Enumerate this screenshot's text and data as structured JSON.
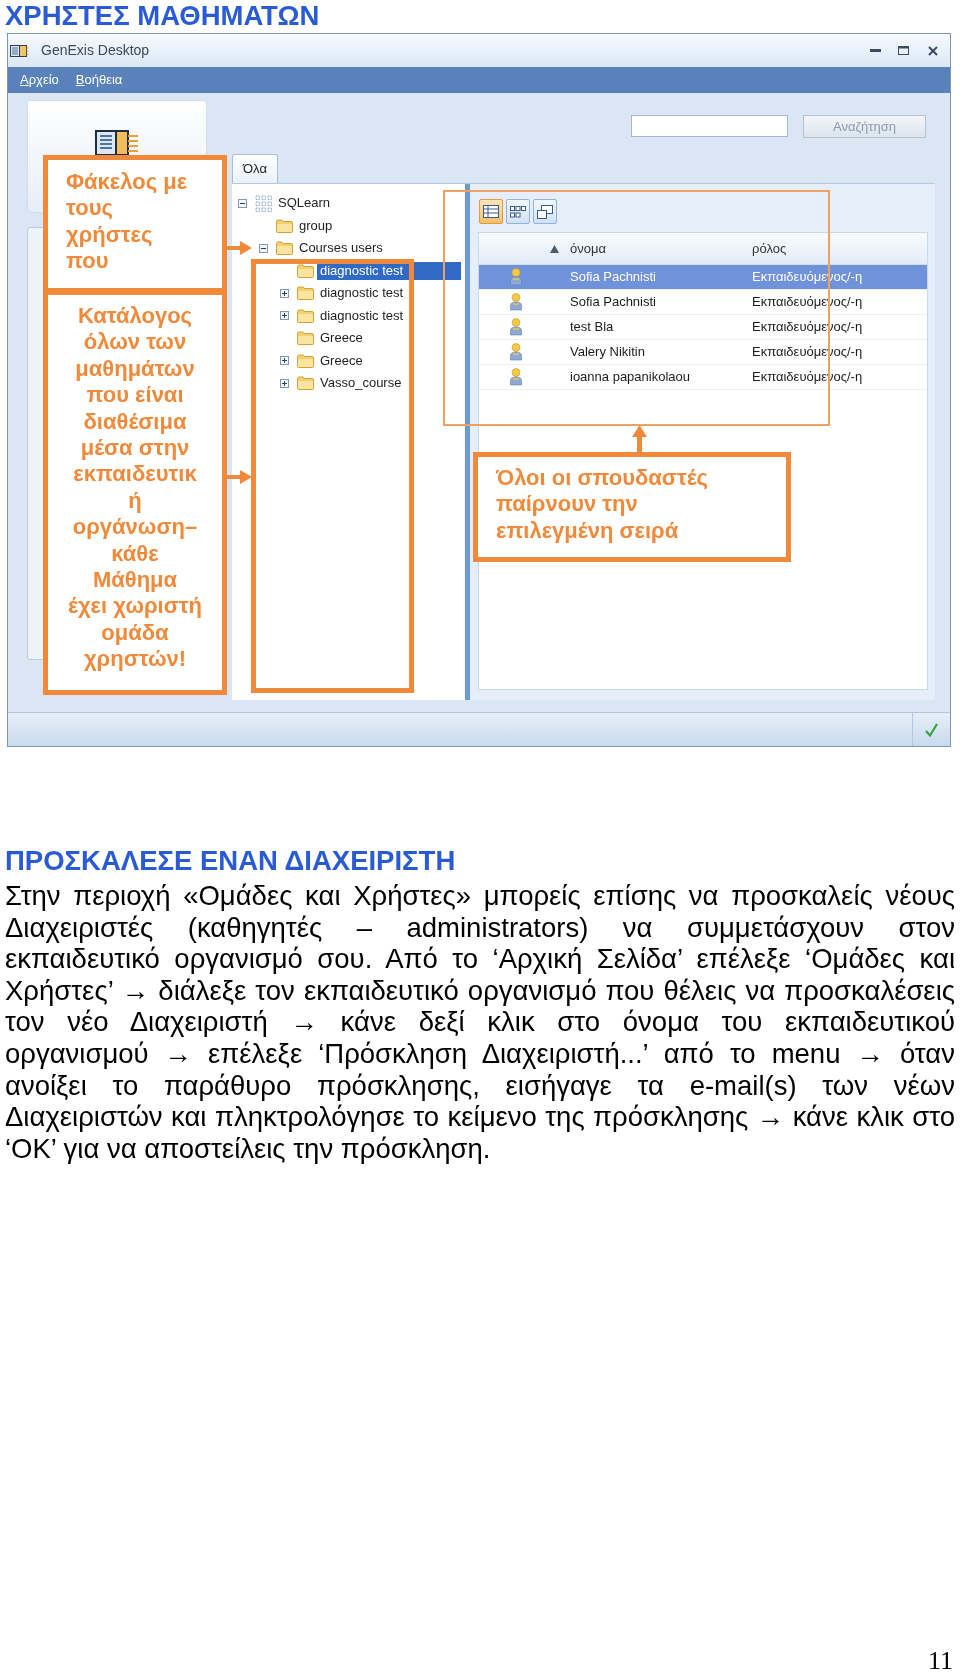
{
  "title": "ΧΡΗΣΤΕΣ ΜΑΘΗΜΑΤΩΝ",
  "window": {
    "title": "GenExis Desktop",
    "menu": [
      {
        "label": "Αρχείο"
      },
      {
        "label": "Βοήθεια"
      }
    ],
    "search": {
      "button": {
        "label": "Αναζήτηση",
        "disabled": true
      }
    },
    "tabs": [
      {
        "label": "Όλα",
        "selected": true
      }
    ],
    "tree": [
      {
        "label": "SQLearn",
        "kind": "root",
        "expanded": true,
        "selected": false,
        "children": [
          {
            "label": "group",
            "kind": "folder",
            "selected": false
          },
          {
            "label": "Courses users",
            "kind": "folder",
            "expanded": true,
            "selected": false,
            "children": [
              {
                "label": "diagnostic test",
                "kind": "folder",
                "selected": true
              },
              {
                "label": "diagnostic test",
                "kind": "folder",
                "expanded": false,
                "selected": false
              },
              {
                "label": "diagnostic test",
                "kind": "folder",
                "expanded": false,
                "selected": false
              },
              {
                "label": "Greece",
                "kind": "folder",
                "selected": false
              },
              {
                "label": "Greece",
                "kind": "folder",
                "expanded": false,
                "selected": false
              },
              {
                "label": "Vasso_course",
                "kind": "folder",
                "expanded": false,
                "selected": false
              }
            ]
          }
        ]
      }
    ],
    "view_buttons": [
      {
        "kind": "details",
        "selected": true
      },
      {
        "kind": "icons",
        "selected": false
      },
      {
        "kind": "tiles",
        "selected": false
      }
    ],
    "table": {
      "columns": [
        {
          "label": "όνομα",
          "sorted": true
        },
        {
          "label": "ρόλος",
          "sorted": false
        }
      ],
      "rows": [
        {
          "name": "Sofia Pachnisti",
          "role": "Εκπαιδευόμενος/-η",
          "selected": true
        },
        {
          "name": "Sofia Pachnisti",
          "role": "Εκπαιδευόμενος/-η",
          "selected": false
        },
        {
          "name": "test Bla",
          "role": "Εκπαιδευόμενος/-η",
          "selected": false
        },
        {
          "name": "Valery Nikitin",
          "role": "Εκπαιδευόμενος/-η",
          "selected": false
        },
        {
          "name": "ioanna papanikolaou",
          "role": "Εκπαιδευόμενος/-η",
          "selected": false
        }
      ]
    }
  },
  "callouts": [
    {
      "lines": [
        "Φάκελος με",
        "τους",
        "χρήστες",
        "που"
      ]
    },
    {
      "lines": [
        "Κατάλογος",
        "όλων των",
        "μαθημάτων",
        "που είναι",
        "διαθέσιμα",
        "μέσα στην",
        "εκπαιδευτικ",
        "ή",
        "οργάνωση–",
        "κάθε",
        "Μάθημα",
        "έχει χωριστή",
        "ομάδα",
        "χρηστών!"
      ]
    },
    {
      "lines": [
        "Όλοι οι σπουδαστές",
        "παίρνουν την",
        "επιλεγμένη σειρά"
      ]
    }
  ],
  "section": {
    "heading": "ΠΡΟΣΚΑΛΕΣΕ ΕΝΑΝ ΔΙΑΧΕΙΡΙΣΤΗ",
    "text": "Στην περιοχή «Ομάδες και Χρήστες» μπορείς επίσης να προσκαλείς νέους Διαχειριστές (καθηγητές – administrators) να συμμετάσχουν στον εκπαιδευτικό οργανισμό σου. Από το ‘Αρχική Σελίδα’ επέλεξε ‘Ομάδες και Χρήστες’ → διάλεξε τον εκπαιδευτικό οργανισμό που θέλεις να προσκαλέσεις τον νέο Διαχειριστή → κάνε δεξί κλικ στο όνομα του εκπαιδευτικού οργανισμού → επέλεξε ‘Πρόσκληση Διαχειριστή...’ από το menu → όταν ανοίξει το παράθυρο πρόσκλησης, εισήγαγε τα e-mail(s) των νέων Διαχειριστών και πληκτρολόγησε το κείμενο της πρόσκλησης → κάνε κλικ στο ‘OK’ για να αποστείλεις την πρόσκληση."
  },
  "page_number": "11"
}
